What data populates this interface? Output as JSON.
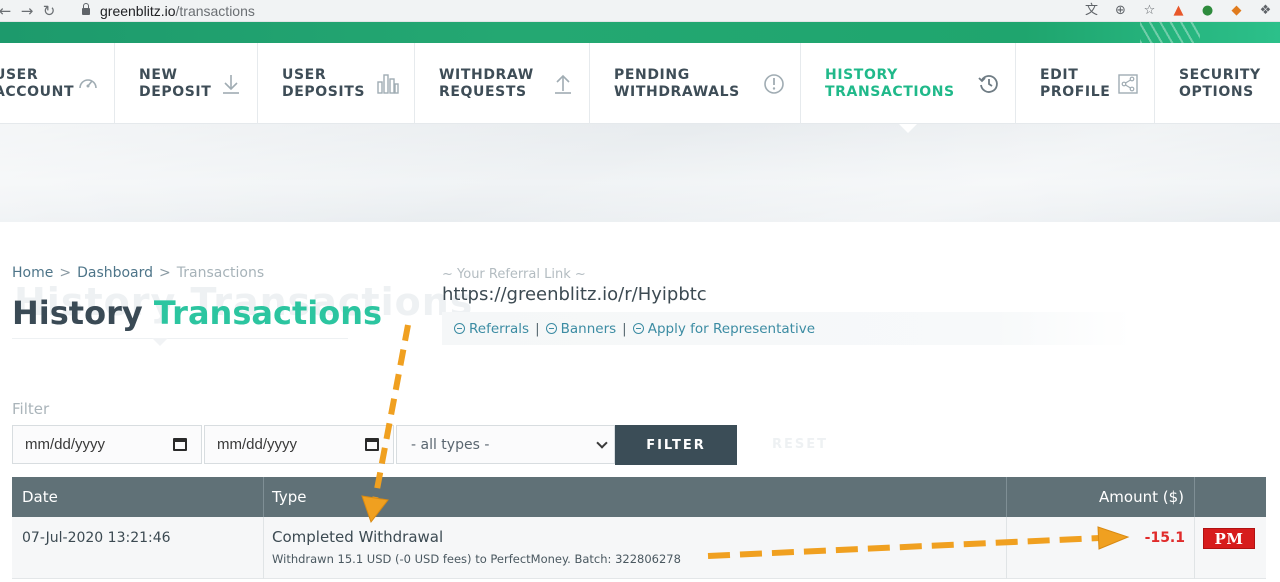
{
  "browser": {
    "url_host": "greenblitz.io",
    "url_path": "/transactions",
    "icons": [
      "translate-icon",
      "zoom-icon",
      "star-icon",
      "extension-fire-icon",
      "extension-globe-icon",
      "metamask-icon",
      "extensions-puzzle-icon"
    ]
  },
  "nav": {
    "items": [
      {
        "label": "USER\nACCOUNT",
        "icon": "speedometer-icon",
        "active": false
      },
      {
        "label": "NEW\nDEPOSIT",
        "icon": "download-arrow-icon",
        "active": false
      },
      {
        "label": "USER\nDEPOSITS",
        "icon": "bar-chart-icon",
        "active": false
      },
      {
        "label": "WITHDRAW\nREQUESTS",
        "icon": "upload-arrow-icon",
        "active": false
      },
      {
        "label": "PENDING\nWITHDRAWALS",
        "icon": "exclamation-circle-icon",
        "active": false
      },
      {
        "label": "HISTORY\nTRANSACTIONS",
        "icon": "history-clock-icon",
        "active": true
      },
      {
        "label": "EDIT\nPROFILE",
        "icon": "share-icon",
        "active": false
      },
      {
        "label": "SECURITY\nOPTIONS",
        "icon": "shield-icon",
        "active": false
      }
    ]
  },
  "breadcrumb": {
    "home": "Home",
    "dashboard": "Dashboard",
    "current": "Transactions",
    "separator": ">"
  },
  "page": {
    "title_part1": "History",
    "title_part2": "Transactions",
    "title_ghost": "History Transactions"
  },
  "referral": {
    "label": "~ Your Referral Link ~",
    "link": "https://greenblitz.io/r/Hyipbtc",
    "links": [
      "Referrals",
      "Banners",
      "Apply for Representative"
    ],
    "separator": "|"
  },
  "filter": {
    "label": "Filter",
    "date_from_placeholder": "mm/dd/yyyy",
    "date_to_placeholder": "mm/dd/yyyy",
    "type_selected": "- all types -",
    "filter_button": "FILTER",
    "reset_button": "RESET"
  },
  "table": {
    "headers": {
      "date": "Date",
      "type": "Type",
      "amount": "Amount ($)",
      "ps": ""
    },
    "rows": [
      {
        "date": "07-Jul-2020 13:21:46",
        "type": "Completed Withdrawal",
        "details": "Withdrawn 15.1 USD (-0 USD fees) to PerfectMoney. Batch: 322806278",
        "amount": "-15.1",
        "payment_system": "PM"
      }
    ]
  },
  "colors": {
    "accent_green": "#20b98a",
    "title_green": "#2cc5a0",
    "header_gray": "#607177",
    "button_dark": "#3b4d57",
    "negative_red": "#e02b2b",
    "annotation_orange": "#f0a020"
  }
}
